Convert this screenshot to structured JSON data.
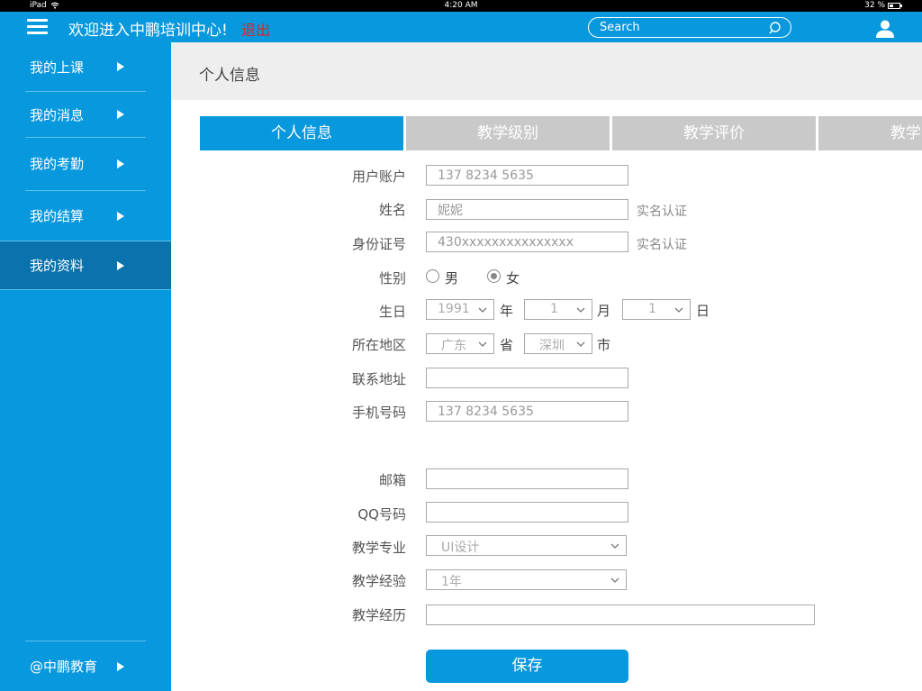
{
  "status_bar": {
    "device": "iPad",
    "time": "4:20 AM",
    "battery": "32 %"
  },
  "header": {
    "title": "欢迎进入中鹏培训中心!",
    "logout": "退出",
    "search_placeholder": "Search"
  },
  "sidebar": {
    "items": [
      {
        "label": "我的上课"
      },
      {
        "label": "我的消息"
      },
      {
        "label": "我的考勤"
      },
      {
        "label": "我的结算"
      },
      {
        "label": "我的资料"
      }
    ],
    "footer": "@中鹏教育"
  },
  "page": {
    "title": "个人信息"
  },
  "tabs": [
    {
      "label": "个人信息"
    },
    {
      "label": "教学级别"
    },
    {
      "label": "教学评价"
    },
    {
      "label": "教学"
    }
  ],
  "form": {
    "account": {
      "label": "用户账户",
      "value": "137 8234 5635"
    },
    "name": {
      "label": "姓名",
      "value": "妮妮",
      "hint": "实名认证"
    },
    "id_number": {
      "label": "身份证号",
      "value": "430xxxxxxxxxxxxxxx",
      "hint": "实名认证"
    },
    "gender": {
      "label": "性别",
      "male": "男",
      "female": "女",
      "selected": "女"
    },
    "birthday": {
      "label": "生日",
      "year": "1991",
      "year_unit": "年",
      "month": "1",
      "month_unit": "月",
      "day": "1",
      "day_unit": "日"
    },
    "region": {
      "label": "所在地区",
      "province": "广东",
      "province_unit": "省",
      "city": "深圳",
      "city_unit": "市"
    },
    "address": {
      "label": "联系地址",
      "value": ""
    },
    "mobile": {
      "label": "手机号码",
      "value": "137 8234 5635"
    },
    "email": {
      "label": "邮箱",
      "value": ""
    },
    "qq": {
      "label": "QQ号码",
      "value": ""
    },
    "major": {
      "label": "教学专业",
      "value": "UI设计"
    },
    "experience": {
      "label": "教学经验",
      "value": "1年"
    },
    "history": {
      "label": "教学经历",
      "value": ""
    },
    "save": "保存"
  },
  "colors": {
    "primary": "#0898dd",
    "active_nav": "#0a73ad",
    "logout": "#d9262e",
    "tab_inactive": "#c9c9c9"
  }
}
